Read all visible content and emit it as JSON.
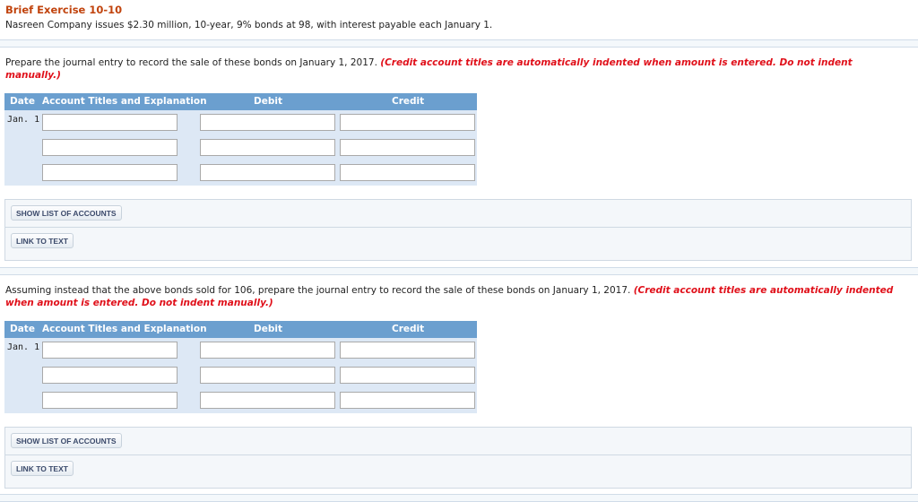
{
  "header": {
    "title": "Brief Exercise 10-10",
    "intro": "Nasreen Company issues $2.30 million, 10-year, 9% bonds at 98, with interest payable each January 1."
  },
  "parts": [
    {
      "prompt": "Prepare the journal entry to record the sale of these bonds on January 1, 2017.",
      "note": "(Credit account titles are automatically indented when amount is entered. Do not indent manually.)",
      "columns": {
        "date": "Date",
        "account": "Account Titles and Explanation",
        "debit": "Debit",
        "credit": "Credit"
      },
      "rows": [
        {
          "date": "Jan. 1",
          "account": "",
          "debit": "",
          "credit": ""
        },
        {
          "date": "",
          "account": "",
          "debit": "",
          "credit": ""
        },
        {
          "date": "",
          "account": "",
          "debit": "",
          "credit": ""
        }
      ],
      "buttons": {
        "show_accounts": "SHOW LIST OF ACCOUNTS",
        "link_text": "LINK TO TEXT"
      }
    },
    {
      "prompt": "Assuming instead that the above bonds sold for 106, prepare the journal entry to record the sale of these bonds on January 1, 2017.",
      "note": "(Credit account titles are automatically indented when amount is entered. Do not indent manually.)",
      "columns": {
        "date": "Date",
        "account": "Account Titles and Explanation",
        "debit": "Debit",
        "credit": "Credit"
      },
      "rows": [
        {
          "date": "Jan. 1",
          "account": "",
          "debit": "",
          "credit": ""
        },
        {
          "date": "",
          "account": "",
          "debit": "",
          "credit": ""
        },
        {
          "date": "",
          "account": "",
          "debit": "",
          "credit": ""
        }
      ],
      "buttons": {
        "show_accounts": "SHOW LIST OF ACCOUNTS",
        "link_text": "LINK TO TEXT"
      }
    }
  ]
}
